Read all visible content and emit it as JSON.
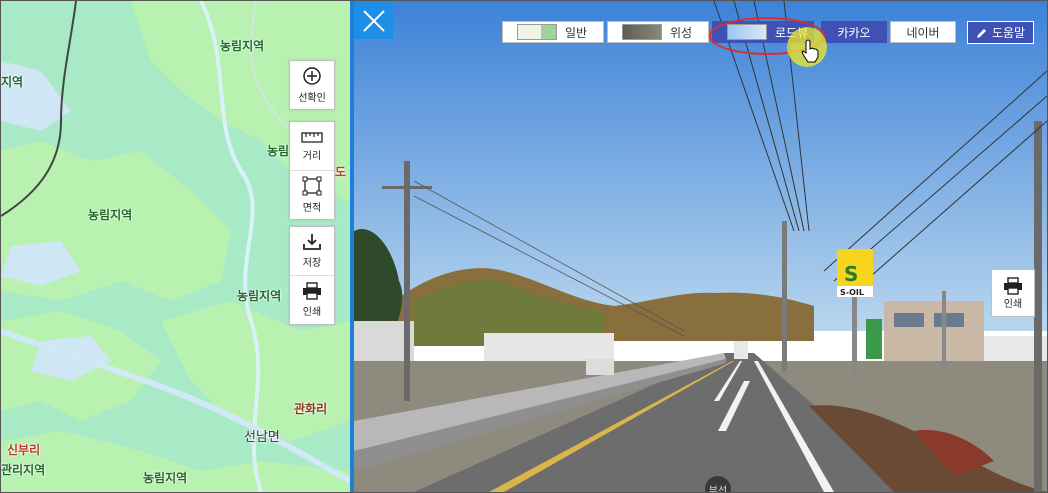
{
  "map": {
    "labels": {
      "forest_top": "농림지역",
      "forest_left_top": "지역",
      "forest_mid_right": "농림",
      "forest_mid": "농림지역",
      "forest_right": "농림지역",
      "forest_bottom": "농림지역",
      "forest_bottom_left": "관리지역",
      "place_gwanhwa": "관화리",
      "place_sinbu": "신부리",
      "town_seonnam": "선남면",
      "edge_red": "도"
    },
    "tools": {
      "zoom_label": "선확인",
      "distance_label": "거리",
      "area_label": "면적",
      "save_label": "저장",
      "print_label": "인쇄"
    },
    "colors": {
      "land": "#a8e9c6",
      "forest": "#b8f1b0",
      "water": "#cde6f7"
    }
  },
  "streetview": {
    "view_buttons": {
      "normal": "일반",
      "satellite": "위성",
      "roadview": "로드뷰",
      "kakao": "카카오",
      "naver": "네이버"
    },
    "active_view": "로드뷰",
    "help_label": "도움말",
    "print_label": "인쇄",
    "road_marker": "부선",
    "sign_text": "S-OIL",
    "accent_color": "#3f51b5"
  }
}
